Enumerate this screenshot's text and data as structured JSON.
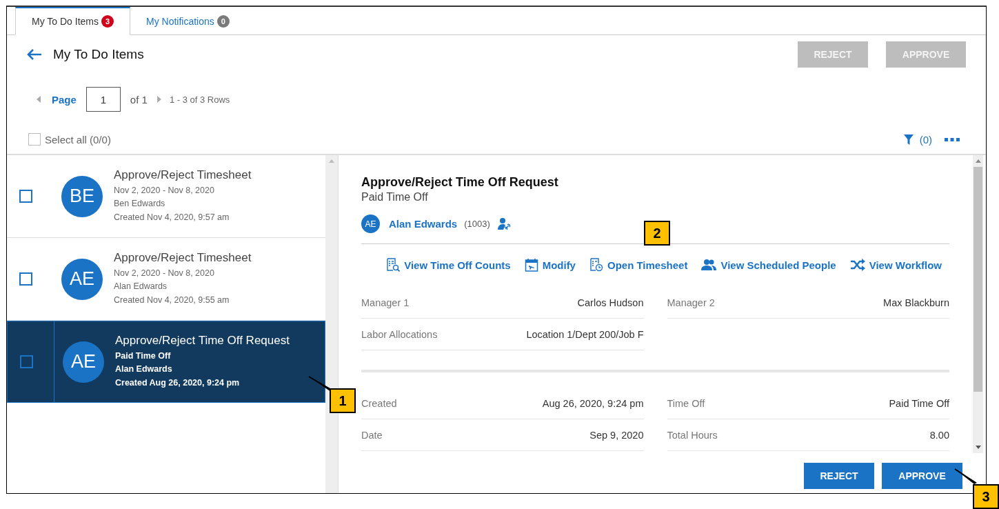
{
  "tabs": [
    {
      "label": "My To Do Items",
      "badge": "3",
      "color": "#d0021b",
      "selected": true
    },
    {
      "label": "My Notifications",
      "badge": "0",
      "color": "#7a7a7a",
      "selected": false
    }
  ],
  "header": {
    "title": "My To Do Items",
    "buttons": [
      {
        "label": "REJECT",
        "disabled": true
      },
      {
        "label": "APPROVE",
        "disabled": true
      }
    ]
  },
  "pager": {
    "label": "Page",
    "value": "1",
    "of": "of 1",
    "rows": "1 - 3 of 3 Rows"
  },
  "select_all": {
    "label": "Select all (0/0)",
    "checked": false
  },
  "filter": {
    "count": "(0)"
  },
  "items": [
    {
      "initials": "BE",
      "title": "Approve/Reject Timesheet",
      "lines": [
        "Nov 2, 2020 - Nov 8, 2020",
        "Ben Edwards",
        "Created Nov 4, 2020, 9:57 am"
      ],
      "checked": false,
      "selected": false
    },
    {
      "initials": "AE",
      "title": "Approve/Reject Timesheet",
      "lines": [
        "Nov 2, 2020 - Nov 8, 2020",
        "Alan Edwards",
        "Created Nov 4, 2020, 9:55 am"
      ],
      "checked": false,
      "selected": false
    },
    {
      "initials": "AE",
      "title": "Approve/Reject Time Off Request",
      "lines": [
        "Paid Time Off",
        "Alan Edwards",
        "Created Aug 26, 2020, 9:24 pm"
      ],
      "checked": false,
      "selected": true
    }
  ],
  "detail": {
    "title": "Approve/Reject Time Off Request",
    "subtitle": "Paid Time Off",
    "person": {
      "initials": "AE",
      "name": "Alan Edwards",
      "id": "(1003)"
    },
    "actions": [
      {
        "kind": "counts",
        "label": "View Time Off Counts"
      },
      {
        "kind": "modify",
        "label": "Modify"
      },
      {
        "kind": "timesheet",
        "label": "Open Timesheet"
      },
      {
        "kind": "people",
        "label": "View Scheduled People"
      },
      {
        "kind": "workflow",
        "label": "View Workflow"
      }
    ],
    "sections": [
      {
        "fields": [
          {
            "label": "Manager 1",
            "value": "Carlos Hudson"
          },
          {
            "label": "Manager 2",
            "value": "Max Blackburn"
          },
          {
            "label": "Labor Allocations",
            "value": "Location 1/Dept 200/Job F"
          }
        ]
      },
      {
        "fields": [
          {
            "label": "Created",
            "value": "Aug 26, 2020, 9:24 pm"
          },
          {
            "label": "Time Off",
            "value": "Paid Time Off"
          },
          {
            "label": "Date",
            "value": "Sep 9, 2020"
          },
          {
            "label": "Total Hours",
            "value": "8.00"
          }
        ]
      }
    ],
    "buttons": [
      {
        "label": "REJECT"
      },
      {
        "label": "APPROVE"
      }
    ]
  },
  "callouts": [
    "1",
    "2",
    "3"
  ]
}
